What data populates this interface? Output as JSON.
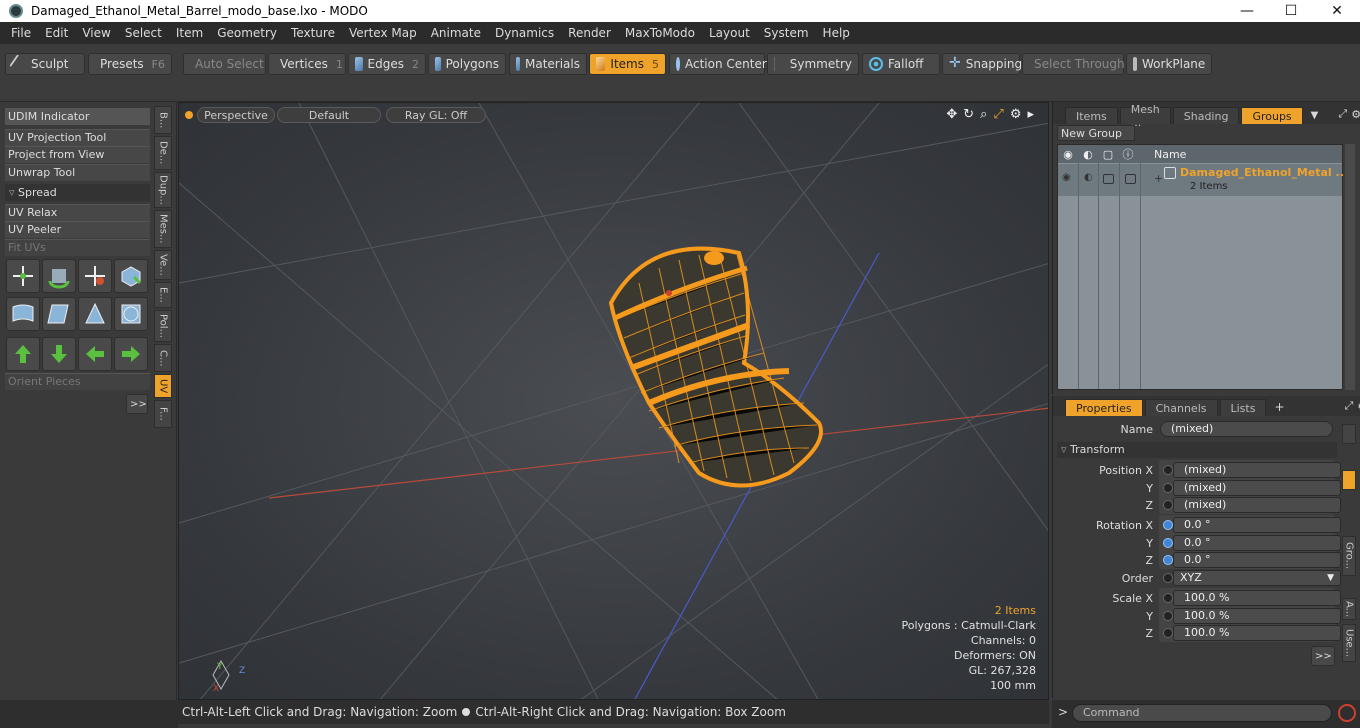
{
  "window": {
    "title": "Damaged_Ethanol_Metal_Barrel_modo_base.lxo - MODO",
    "minimize": "—",
    "maximize": "☐",
    "close": "✕"
  },
  "menu": [
    "File",
    "Edit",
    "View",
    "Select",
    "Item",
    "Geometry",
    "Texture",
    "Vertex Map",
    "Animate",
    "Dynamics",
    "Render",
    "MaxToModo",
    "Layout",
    "System",
    "Help"
  ],
  "toolbar": {
    "sculpt": "Sculpt",
    "presets": "Presets",
    "presets_key": "F6",
    "auto_select": "Auto Select",
    "vertices": "Vertices",
    "vertices_key": "1",
    "edges": "Edges",
    "edges_key": "2",
    "polygons": "Polygons",
    "materials": "Materials",
    "items": "Items",
    "items_key": "5",
    "action_center": "Action Center",
    "symmetry": "Symmetry",
    "falloff": "Falloff",
    "snapping": "Snapping",
    "select_through": "Select Through",
    "workplane": "WorkPlane"
  },
  "left_panel": {
    "udim": "UDIM Indicator",
    "uv_projection": "UV Projection Tool",
    "project_from_view": "Project from View",
    "unwrap": "Unwrap Tool",
    "spread": "Spread",
    "uv_relax": "UV Relax",
    "uv_peeler": "UV Peeler",
    "fit_uvs": "Fit UVs",
    "orient_pieces": "Orient Pieces",
    "more": ">>",
    "vtabs": [
      "B...",
      "De...",
      "Dup...",
      "Mes...",
      "Ve...",
      "E...",
      "Pol...",
      "C...",
      "UV",
      "F..."
    ]
  },
  "viewport": {
    "perspective": "Perspective",
    "default": "Default",
    "raygl": "Ray GL: Off",
    "info": {
      "items": "2 Items",
      "polygons": "Polygons : Catmull-Clark",
      "channels": "Channels: 0",
      "deformers": "Deformers: ON",
      "gl": "GL: 267,328",
      "scale": "100 mm"
    }
  },
  "status": {
    "left": "Ctrl-Alt-Left Click and Drag: Navigation: Zoom",
    "right": "Ctrl-Alt-Right Click and Drag: Navigation: Box Zoom"
  },
  "right_top": {
    "tabs": [
      "Items",
      "Mesh ...",
      "Shading",
      "Groups"
    ],
    "new_group": "New Group",
    "col_name": "Name",
    "group_name": "Damaged_Ethanol_Metal ...",
    "group_count": "2 Items"
  },
  "properties": {
    "tabs": [
      "Properties",
      "Channels",
      "Lists"
    ],
    "plus": "+",
    "name_label": "Name",
    "name_value": "(mixed)",
    "transform": "Transform",
    "position_x_label": "Position X",
    "y_label": "Y",
    "z_label": "Z",
    "pos_x": "(mixed)",
    "pos_y": "(mixed)",
    "pos_z": "(mixed)",
    "rotation_x_label": "Rotation X",
    "rot_x": "0.0 °",
    "rot_y": "0.0 °",
    "rot_z": "0.0 °",
    "order_label": "Order",
    "order_value": "XYZ",
    "scale_x_label": "Scale X",
    "scale_x": "100.0 %",
    "scale_y": "100.0 %",
    "scale_z": "100.0 %",
    "more": ">>",
    "vtabs": [
      "Gro...",
      "A...",
      "Use..."
    ]
  },
  "command": {
    "placeholder": "Command",
    "prompt": ">"
  }
}
